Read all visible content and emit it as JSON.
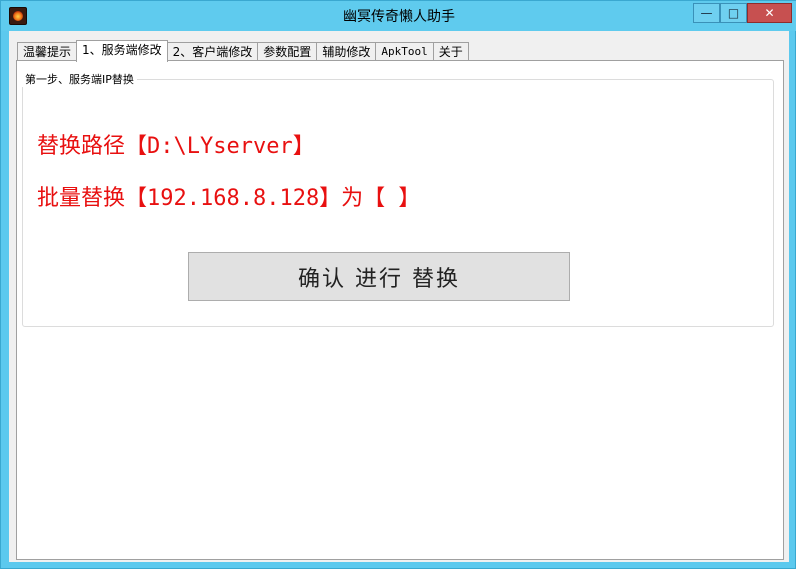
{
  "window": {
    "title": "幽冥传奇懒人助手",
    "controls": {
      "minimize": "—",
      "maximize": "□",
      "close": "✕"
    }
  },
  "tabs": [
    {
      "label": "温馨提示",
      "active": false
    },
    {
      "label": "1、服务端修改",
      "active": true
    },
    {
      "label": "2、客户端修改",
      "active": false
    },
    {
      "label": "参数配置",
      "active": false
    },
    {
      "label": "辅助修改",
      "active": false
    },
    {
      "label": "ApkTool",
      "active": false
    },
    {
      "label": "关于",
      "active": false
    }
  ],
  "group": {
    "legend": "第一步、服务端IP替换"
  },
  "content": {
    "replace_path": "替换路径【D:\\LYserver】",
    "batch_replace": "批量替换【192.168.8.128】为【 】",
    "confirm_label": "确认 进行 替换"
  },
  "colors": {
    "titlebar": "#5fcbee",
    "highlight_text": "#e81010",
    "close_button": "#c75050"
  }
}
